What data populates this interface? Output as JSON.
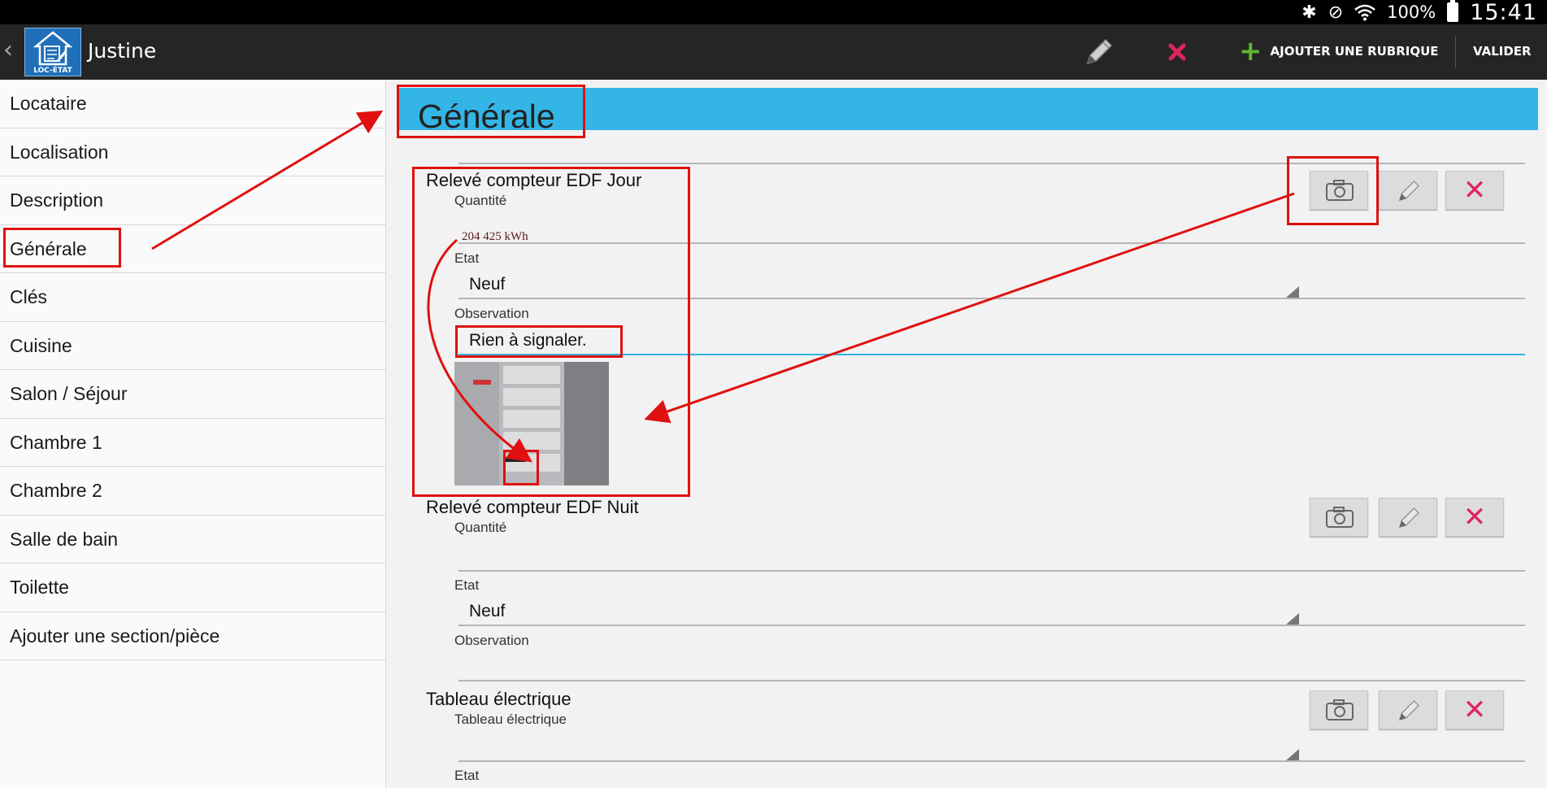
{
  "status_bar": {
    "battery": "100%",
    "time": "15:41"
  },
  "action_bar": {
    "title": "Justine",
    "logo_text": "LOC-ÉTAT",
    "add_label": "AJOUTER UNE RUBRIQUE",
    "validate_label": "VALIDER"
  },
  "sidebar": {
    "items": [
      {
        "label": "Locataire"
      },
      {
        "label": "Localisation"
      },
      {
        "label": "Description"
      },
      {
        "label": "Générale"
      },
      {
        "label": "Clés"
      },
      {
        "label": "Cuisine"
      },
      {
        "label": "Salon / Séjour"
      },
      {
        "label": "Chambre 1"
      },
      {
        "label": "Chambre 2"
      },
      {
        "label": "Salle de bain"
      },
      {
        "label": "Toilette"
      },
      {
        "label": "Ajouter une section/pièce"
      }
    ]
  },
  "main": {
    "title": "Générale",
    "sections": [
      {
        "title": "Relevé compteur EDF Jour",
        "qty_label": "Quantité",
        "qty_value": "204 425 kWh",
        "etat_label": "Etat",
        "etat_value": "Neuf",
        "obs_label": "Observation",
        "obs_value": "Rien à signaler."
      },
      {
        "title": "Relevé compteur EDF Nuit",
        "qty_label": "Quantité",
        "qty_value": "",
        "etat_label": "Etat",
        "etat_value": "Neuf",
        "obs_label": "Observation",
        "obs_value": ""
      },
      {
        "title": "Tableau électrique",
        "field_label": "Tableau électrique",
        "etat_label": "Etat"
      }
    ]
  },
  "colors": {
    "accent": "#33b5e5",
    "delete": "#e0245e",
    "add": "#5cb82e",
    "annotation": "#e01010"
  },
  "icons": [
    "bluetooth-icon",
    "mute-icon",
    "wifi-icon",
    "battery-icon",
    "back-icon",
    "pencil-icon",
    "close-icon",
    "plus-icon",
    "camera-icon"
  ]
}
